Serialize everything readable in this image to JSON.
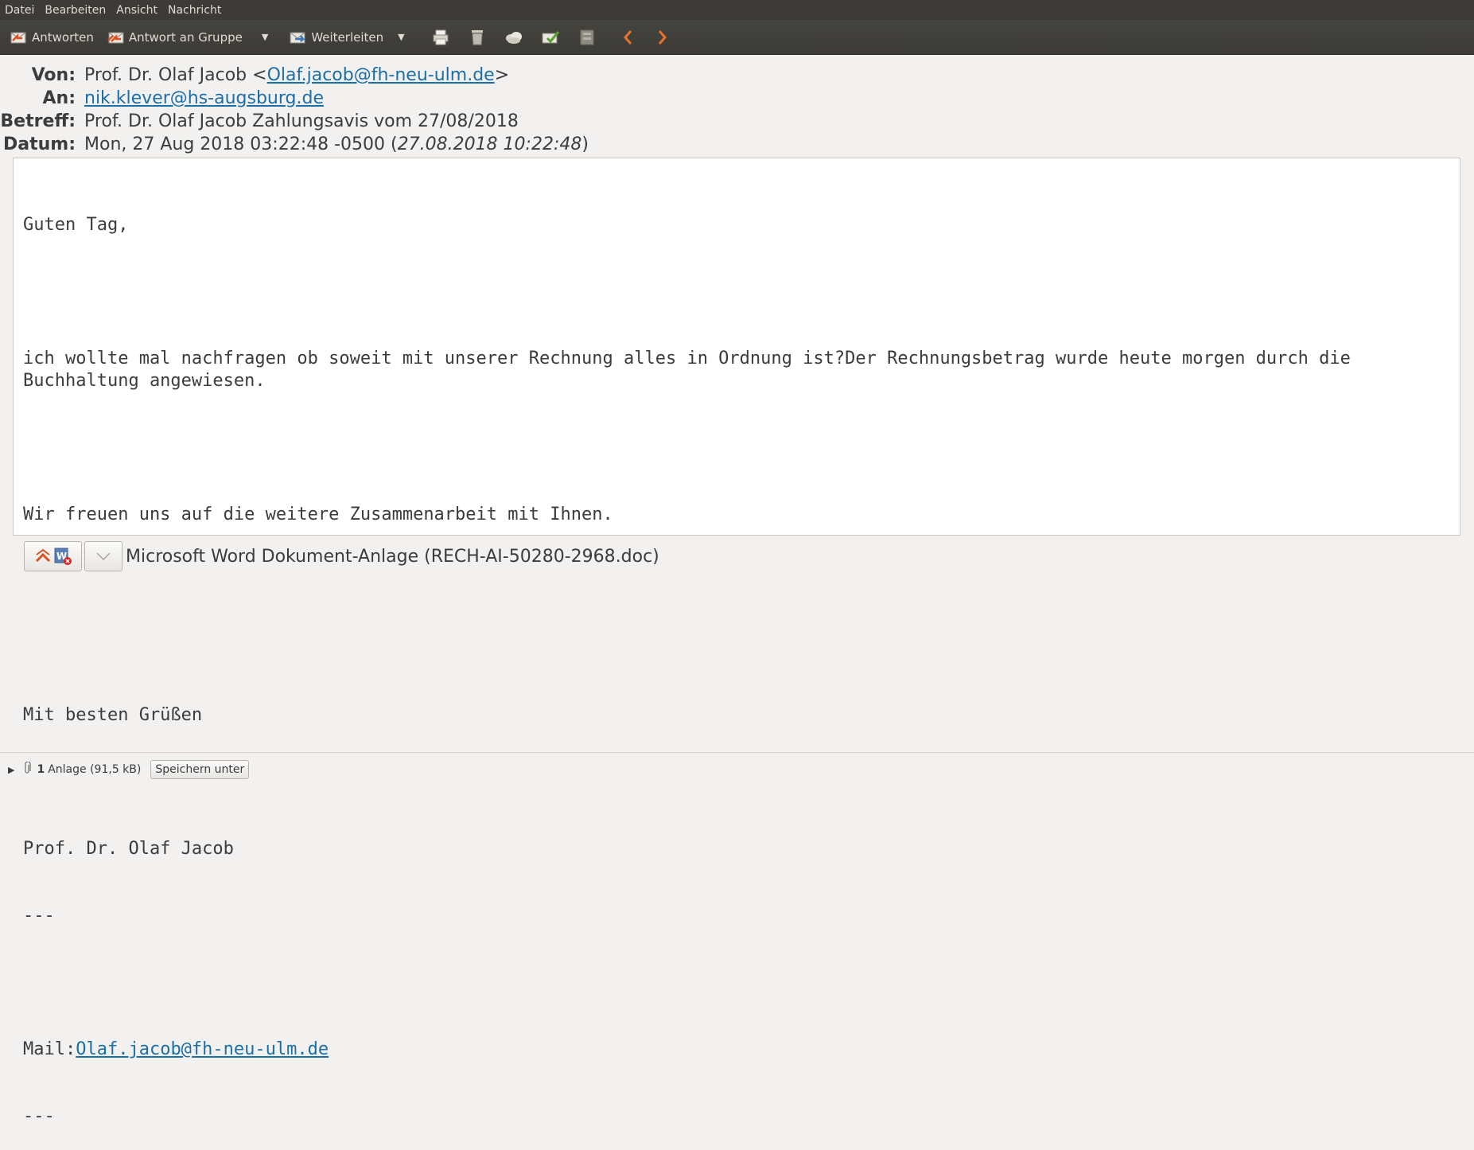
{
  "menubar": {
    "items": [
      {
        "label": "Datei"
      },
      {
        "label": "Bearbeiten"
      },
      {
        "label": "Ansicht"
      },
      {
        "label": "Nachricht"
      }
    ]
  },
  "toolbar": {
    "reply_label": "Antworten",
    "reply_all_label": "Antwort an Gruppe",
    "forward_label": "Weiterleiten",
    "icons": [
      "reply-icon",
      "reply-all-icon",
      "forward-icon",
      "print-icon",
      "trash-icon",
      "junk-icon",
      "mark-not-junk-icon",
      "archive-icon",
      "previous-arrow-icon",
      "next-arrow-icon"
    ],
    "accent_color": "#e8722b"
  },
  "headers": {
    "from_label": "Von:",
    "from_name": "Prof. Dr. Olaf Jacob <",
    "from_email": "Olaf.jacob@fh-neu-ulm.de",
    "from_suffix": ">",
    "to_label": "An:",
    "to_email": "nik.klever@hs-augsburg.de",
    "subject_label": "Betreff:",
    "subject": "Prof. Dr. Olaf Jacob Zahlungsavis vom 27/08/2018",
    "date_label": "Datum:",
    "date": "Mon, 27 Aug 2018 03:22:48 -0500 (",
    "date_local": "27.08.2018 10:22:48",
    "date_suffix": ")"
  },
  "body": {
    "greeting": "Guten Tag,",
    "line1": "ich wollte mal nachfragen ob soweit mit unserer Rechnung alles in Ordnung ist?Der Rechnungsbetrag wurde heute morgen durch die Buchhaltung angewiesen.",
    "line2": "Wir freuen uns auf die weitere Zusammenarbeit mit Ihnen.",
    "closing": "Mit besten Grüßen",
    "signature": "Prof. Dr. Olaf Jacob",
    "sep1": "---",
    "mail_label": "Mail:",
    "mail_link": "Olaf.jacob@fh-neu-ulm.de",
    "sep2": "---",
    "link_color": "#1a6fa8"
  },
  "attachment": {
    "name": "Microsoft Word Dokument-Anlage (RECH-AI-50280-2968.doc)"
  },
  "footer": {
    "count": "1",
    "summary": "Anlage (91,5 kB)",
    "save_label": "Speichern unter"
  }
}
